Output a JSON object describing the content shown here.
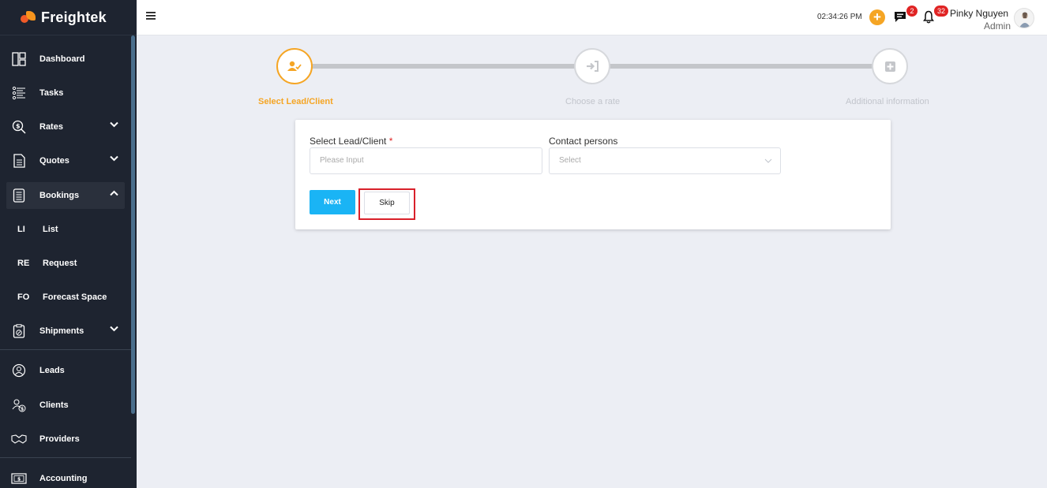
{
  "brand": {
    "name": "Freightek"
  },
  "sidebar": {
    "items": [
      {
        "label": "Dashboard",
        "icon": "dashboard-icon"
      },
      {
        "label": "Tasks",
        "icon": "tasks-icon"
      },
      {
        "label": "Rates",
        "icon": "rates-icon"
      },
      {
        "label": "Quotes",
        "icon": "quotes-icon"
      },
      {
        "label": "Bookings",
        "icon": "bookings-icon"
      },
      {
        "label": "Shipments",
        "icon": "shipments-icon"
      },
      {
        "label": "Leads",
        "icon": "leads-icon"
      },
      {
        "label": "Clients",
        "icon": "clients-icon"
      },
      {
        "label": "Providers",
        "icon": "providers-icon"
      },
      {
        "label": "Accounting",
        "icon": "accounting-icon"
      }
    ],
    "bookings_sub": [
      {
        "abbr": "LI",
        "label": "List"
      },
      {
        "abbr": "RE",
        "label": "Request"
      },
      {
        "abbr": "FO",
        "label": "Forecast Space"
      }
    ]
  },
  "topbar": {
    "time": "02:34:26 PM",
    "chat_count": "2",
    "notification_count": "32",
    "user_name": "Pinky Nguyen",
    "user_role": "Admin"
  },
  "stepper": {
    "steps": [
      {
        "label": "Select Lead/Client",
        "icon": "user-check-icon"
      },
      {
        "label": "Choose a rate",
        "icon": "sign-in-icon"
      },
      {
        "label": "Additional information",
        "icon": "plus-square-icon"
      }
    ]
  },
  "form": {
    "lead_label": "Select Lead/Client",
    "required_mark": "*",
    "lead_placeholder": "Please Input",
    "contact_label": "Contact persons",
    "contact_placeholder": "Select",
    "next_label": "Next",
    "skip_label": "Skip"
  },
  "colors": {
    "accent": "#f5a524",
    "primary_button": "#1ab4f5",
    "sidebar_bg": "#1e2430",
    "badge": "#e02424",
    "highlight": "#d9202a"
  }
}
